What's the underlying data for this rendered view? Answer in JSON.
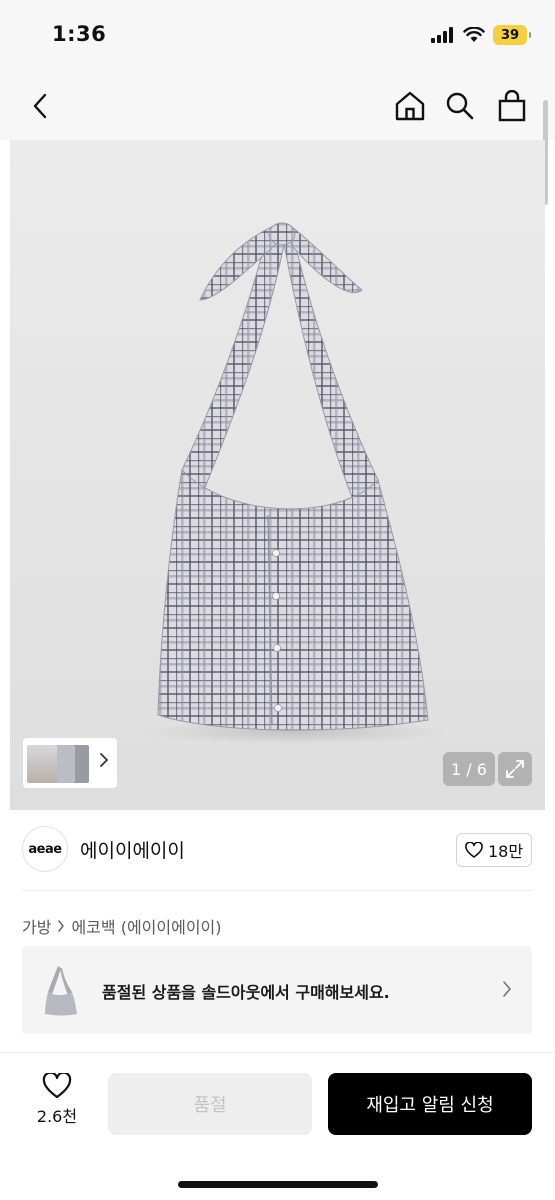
{
  "status_bar": {
    "time": "1:36",
    "battery": "39"
  },
  "nav": {
    "back_icon": "chevron-left-icon",
    "home_icon": "home-icon",
    "search_icon": "search-icon",
    "bag_icon": "shopping-bag-icon"
  },
  "gallery": {
    "counter": "1 / 6",
    "expand_icon": "expand-icon",
    "thumbnails_chevron_icon": "chevron-right-icon"
  },
  "brand": {
    "logo_text": "aeae",
    "name": "에이이에이이",
    "likes": "18만"
  },
  "breadcrumb": {
    "category": "가방",
    "subcategory": "에코백 (에이이에이이)"
  },
  "soldout_banner": {
    "text": "품절된 상품을 솔드아웃에서 구매해보세요."
  },
  "bottom_bar": {
    "wish_count": "2.6천",
    "soldout_label": "품절",
    "restock_label": "재입고 알림 신청"
  },
  "colors": {
    "accent": "#000000",
    "battery": "#f4d03f",
    "disabled_bg": "#eeeeee",
    "disabled_text": "#c4c4c4"
  }
}
